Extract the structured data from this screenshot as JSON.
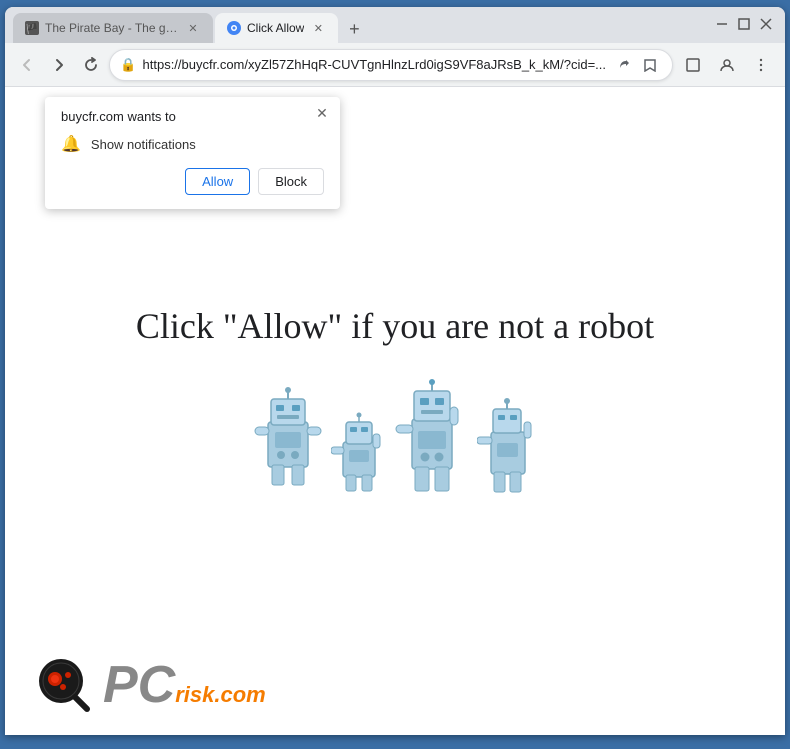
{
  "browser": {
    "tabs": [
      {
        "id": "tab1",
        "label": "The Pirate Bay - The galaxy's mo",
        "favicon": "pirate",
        "active": false
      },
      {
        "id": "tab2",
        "label": "Click Allow",
        "favicon": "chrome",
        "active": true
      }
    ],
    "new_tab_label": "+",
    "address": "https://buycfr.com/xyZl57ZhHqR-CUVTgnHlnzLrd0igS9VF8aJRsB_k_kM/?cid=...",
    "window_controls": {
      "minimize": "−",
      "maximize": "□",
      "close": "✕"
    }
  },
  "nav": {
    "back": "←",
    "forward": "→",
    "refresh": "↻"
  },
  "popup": {
    "title": "buycfr.com wants to",
    "permission_label": "Show notifications",
    "allow_label": "Allow",
    "block_label": "Block",
    "close_icon": "✕"
  },
  "page": {
    "heading": "Click \"Allow\"   if you are not   a robot"
  },
  "pcrisk": {
    "pc_text": "PC",
    "risk_text": "risk.com"
  },
  "icons": {
    "lock": "🔒",
    "bell": "🔔",
    "share": "⬆",
    "star": "☆",
    "window_switch": "⬜",
    "profile": "👤",
    "menu": "⋮"
  }
}
